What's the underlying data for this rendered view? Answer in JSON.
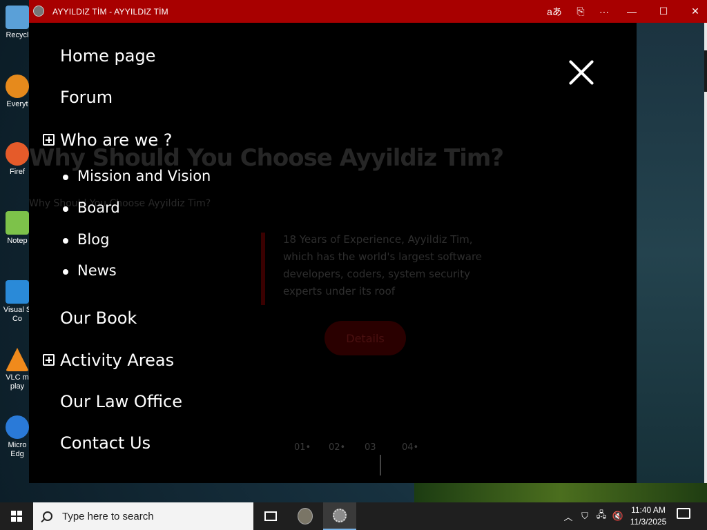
{
  "desktop": {
    "icons": [
      {
        "label": "Recycl",
        "color": "#5aa0d8"
      },
      {
        "label": "Everyt",
        "color": "#e68a1c"
      },
      {
        "label": "Firef",
        "color": "#e55b2a"
      },
      {
        "label": "Notep",
        "color": "#7dc24a"
      },
      {
        "label": "Visual S Co",
        "color": "#2a8ad8"
      },
      {
        "label": "VLC m play",
        "color": "#f08a1c"
      },
      {
        "label": "Micro Edg",
        "color": "#2a7ad8"
      }
    ]
  },
  "window": {
    "title": "AYYILDIZ TİM - AYYILDIZ TİM",
    "title_bar_color": "#a80000",
    "controls": {
      "translate": "aあ",
      "reader": "⎘",
      "more": "···",
      "minimize": "—",
      "maximize": "☐",
      "close": "✕"
    }
  },
  "menu": {
    "items": [
      {
        "label": "Home page"
      },
      {
        "label": "Forum"
      },
      {
        "label": "Who are we ?",
        "expandable": true
      },
      {
        "label": "Our Book"
      },
      {
        "label": "Activity Areas",
        "expandable": true
      },
      {
        "label": "Our Law Office"
      },
      {
        "label": "Contact Us"
      }
    ],
    "sub_items": [
      {
        "label": "Mission and Vision"
      },
      {
        "label": "Board"
      },
      {
        "label": "Blog"
      },
      {
        "label": "News"
      }
    ],
    "close_icon": "close-icon"
  },
  "background_page": {
    "heading": "Why Should You Choose Ayyildiz Tim?",
    "subheading": "Why Should You Choose Ayyildiz Tim?",
    "paragraph": "18 Years of Experience, Ayyildiz Tim, which has the world's largest software developers, coders, system security experts under its roof",
    "button": "Details",
    "pages": [
      "01•",
      "02•",
      "03",
      "04•"
    ],
    "accent": "#b00000"
  },
  "taskbar": {
    "search_placeholder": "Type here to search",
    "time": "11:40 AM",
    "date": "11/3/2025"
  }
}
